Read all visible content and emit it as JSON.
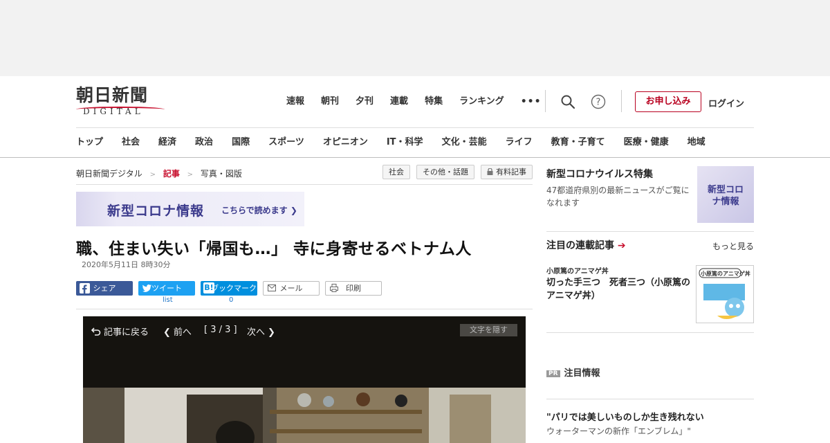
{
  "logo": {
    "main": "朝日新聞",
    "sub": "DIGITAL"
  },
  "topnav": [
    "速報",
    "朝刊",
    "夕刊",
    "連載",
    "特集",
    "ランキング"
  ],
  "topnav_more": "•••",
  "header_buttons": {
    "apply": "お申し込み",
    "login": "ログイン"
  },
  "categories": [
    "トップ",
    "社会",
    "経済",
    "政治",
    "国際",
    "スポーツ",
    "オピニオン",
    "IT・科学",
    "文化・芸能",
    "ライフ",
    "教育・子育て",
    "医療・健康",
    "地域"
  ],
  "breadcrumb": [
    "朝日新聞デジタル",
    "記事",
    "写真・図版"
  ],
  "tags": [
    "社会",
    "その他・話題",
    "有料記事"
  ],
  "corona_banner": {
    "title": "新型コロナ情報",
    "link": "こちらで読めます"
  },
  "article": {
    "title": "職、住まい失い「帰国も…」 寺に身寄せるベトナム人",
    "date": "2020年5月11日 8時30分"
  },
  "share": {
    "facebook": "シェア",
    "twitter": "ツイート",
    "hatena": "ブックマーク",
    "mail": "メール",
    "print": "印刷",
    "twitter_count": "list",
    "hatena_count": "0"
  },
  "viewer": {
    "back": "記事に戻る",
    "prev": "前へ",
    "page": "[ 3 / 3 ]",
    "next": "次へ",
    "hide_text": "文字を隠す"
  },
  "sidebar": {
    "feature": {
      "title": "新型コロナウイルス特集",
      "desc": "47都道府県別の最新ニュースがご覧になれます",
      "thumb": "新型コロナ情報"
    },
    "series": {
      "title": "注目の連載記事",
      "more": "もっと見る",
      "item_kicker": "小原篤のアニマゲ丼",
      "item_title": "切った手三つ　死者三つ（小原篤のアニマゲ丼）",
      "thumb_text": "小原篤のアニマゲ丼"
    },
    "pr": {
      "badge": "PR",
      "title": "注目情報"
    },
    "pr_item": {
      "title": "\"パリでは美しいものしか生き残れない",
      "sub": "ウォーターマンの新作「エンブレム」\""
    }
  },
  "colors": {
    "brand_red": "#c8102e",
    "corona_purple": "#3b3a8c",
    "facebook": "#3b5998",
    "twitter": "#1da1f2",
    "hatena": "#008fde"
  }
}
